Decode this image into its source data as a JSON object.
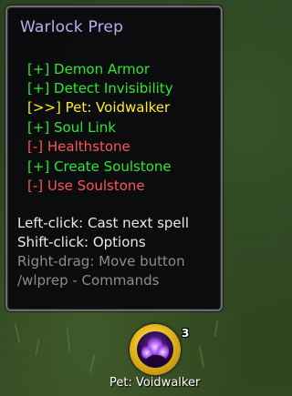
{
  "tooltip": {
    "title": "Warlock Prep",
    "spells": [
      {
        "label": "[+]  Demon Armor",
        "status": "ready"
      },
      {
        "label": "[+]  Detect Invisibility",
        "status": "ready"
      },
      {
        "label": "[>>] Pet: Voidwalker",
        "status": "next"
      },
      {
        "label": "[+]  Soul Link",
        "status": "ready"
      },
      {
        "label": "[-]  Healthstone",
        "status": "missing"
      },
      {
        "label": "[+]  Create Soulstone",
        "status": "ready"
      },
      {
        "label": "[-]  Use Soulstone",
        "status": "missing"
      }
    ],
    "hints": [
      "Left-click: Cast next spell",
      "Shift-click: Options",
      "Right-drag: Move button",
      "/wlprep - Commands"
    ]
  },
  "button": {
    "icon": "voidwalker-icon",
    "count": "3",
    "label": "Pet: Voidwalker"
  },
  "colors": {
    "title": "#b9b0ee",
    "ready": "#2ee82e",
    "next": "#ffee22",
    "missing": "#ff5555",
    "hint": "#e9e9e9",
    "hint_dim": "#8c8c8c",
    "button_ring": "#e6b81c"
  }
}
